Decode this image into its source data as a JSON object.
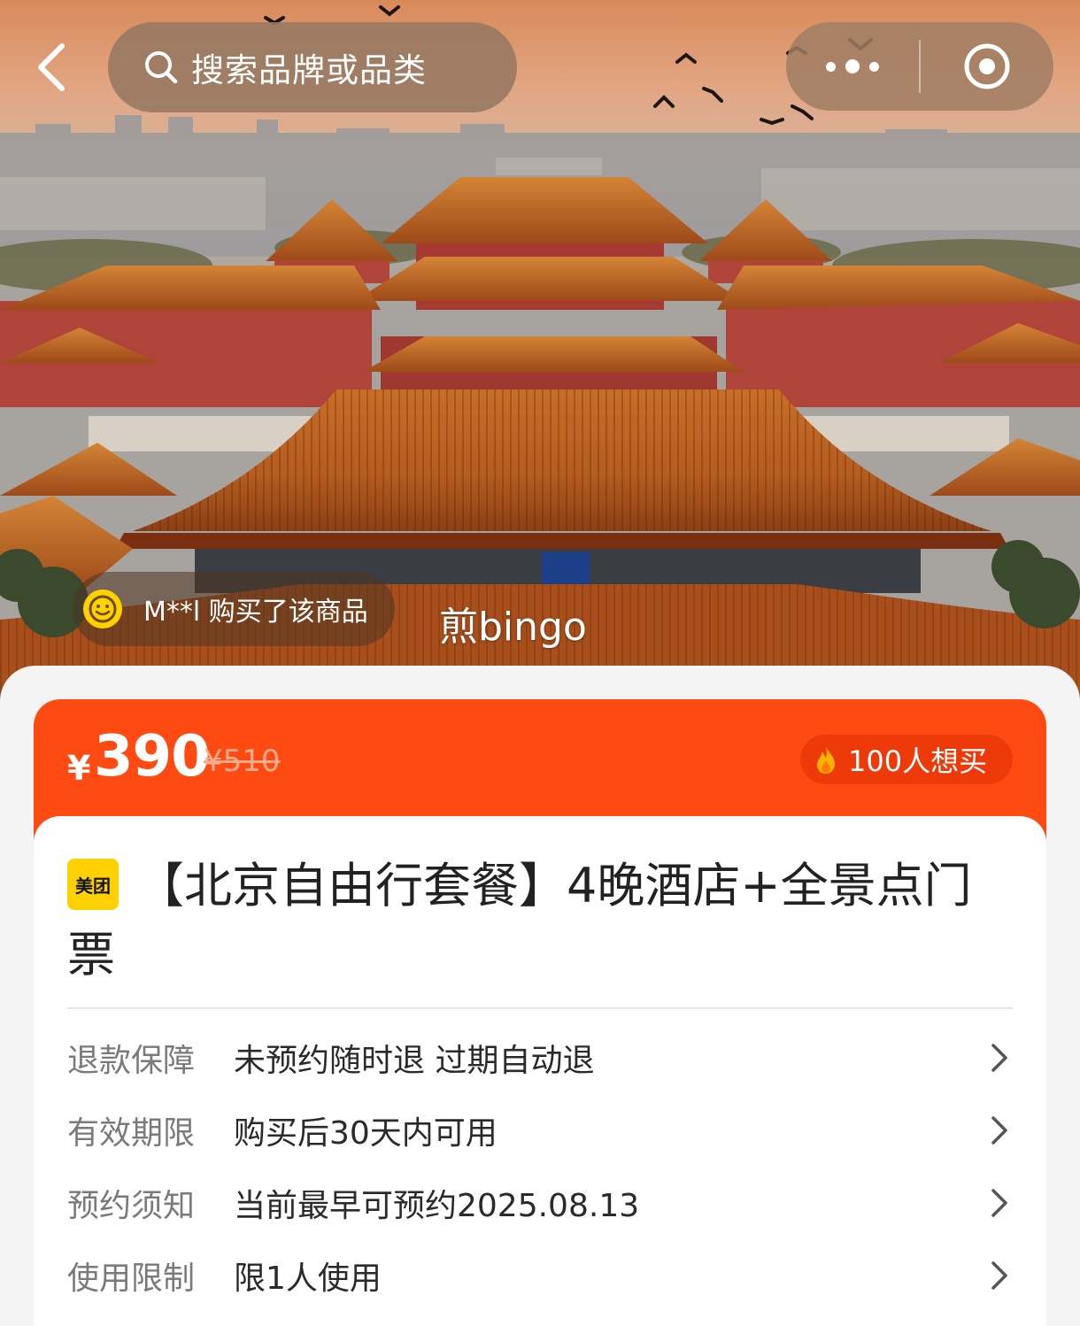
{
  "nav": {
    "search_placeholder": "搜索品牌或品类"
  },
  "hero": {
    "buyer_notice": "M**l 购买了该商品",
    "watermark": "煎bingo"
  },
  "price": {
    "currency": "¥",
    "current": "390",
    "original": "¥510",
    "want_count": "100人想买"
  },
  "product": {
    "brand_badge": "美团",
    "title": "【北京自由行套餐】4晚酒店+全景点门票"
  },
  "info_rows": [
    {
      "label": "退款保障",
      "value": "未预约随时退 过期自动退"
    },
    {
      "label": "有效期限",
      "value": "购买后30天内可用"
    },
    {
      "label": "预约须知",
      "value": "当前最早可预约2025.08.13"
    },
    {
      "label": "使用限制",
      "value": "限1人使用"
    }
  ],
  "colors": {
    "accent": "#ff4b12",
    "brand_yellow": "#ffd100"
  }
}
